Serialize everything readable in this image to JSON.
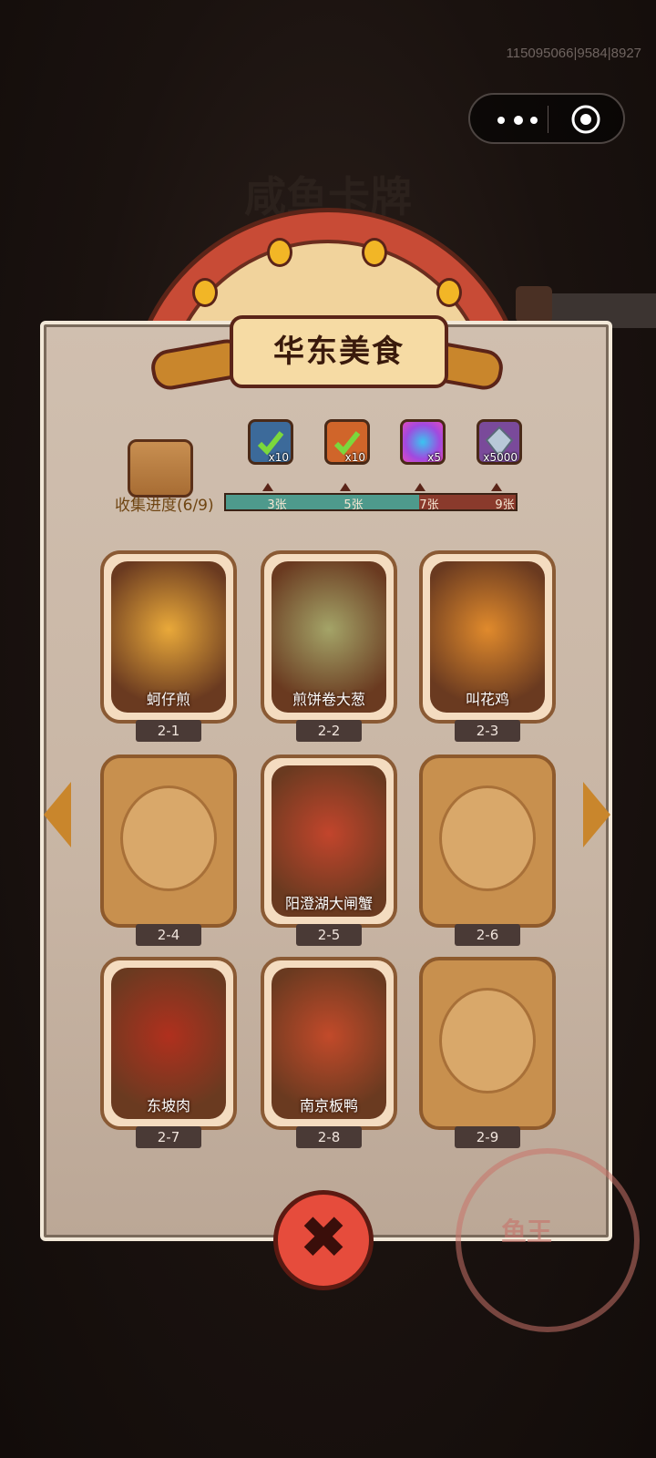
{
  "system": {
    "build_id": "115095066|9584|8927",
    "more_icon": "three-dots-icon",
    "close_icon": "target-circle-icon"
  },
  "background": {
    "title": "咸鱼卡牌"
  },
  "album": {
    "title": "华东美食",
    "progress_label": "收集进度(6/9)",
    "collected": 6,
    "total": 9,
    "milestones": [
      {
        "label": "3张",
        "reward_icon": "green-check-ticket-icon",
        "qty": "x10"
      },
      {
        "label": "5张",
        "reward_icon": "orange-check-ticket-icon",
        "qty": "x10"
      },
      {
        "label": "7张",
        "reward_icon": "purple-swirl-orb-icon",
        "qty": "x5"
      },
      {
        "label": "9张",
        "reward_icon": "crystal-gem-icon",
        "qty": "x5000"
      }
    ],
    "cards": [
      {
        "id": "2-1",
        "name": "蚵仔煎",
        "collected": true,
        "color": "#e9a93a"
      },
      {
        "id": "2-2",
        "name": "煎饼卷大葱",
        "collected": true,
        "color": "#a4a468"
      },
      {
        "id": "2-3",
        "name": "叫花鸡",
        "collected": true,
        "color": "#e08a2c"
      },
      {
        "id": "2-4",
        "name": "",
        "collected": false,
        "color": "#c8904e"
      },
      {
        "id": "2-5",
        "name": "阳澄湖大闸蟹",
        "collected": true,
        "color": "#c2452c"
      },
      {
        "id": "2-6",
        "name": "",
        "collected": false,
        "color": "#c8904e"
      },
      {
        "id": "2-7",
        "name": "东坡肉",
        "collected": true,
        "color": "#b0301e"
      },
      {
        "id": "2-8",
        "name": "南京板鸭",
        "collected": true,
        "color": "#c24a2a"
      },
      {
        "id": "2-9",
        "name": "",
        "collected": false,
        "color": "#c8904e"
      }
    ],
    "prev_icon": "left-arrow-icon",
    "next_icon": "right-arrow-icon",
    "close_button_icon": "close-x-icon",
    "close_glyph": "✖",
    "stamp_text": "鱼王"
  }
}
